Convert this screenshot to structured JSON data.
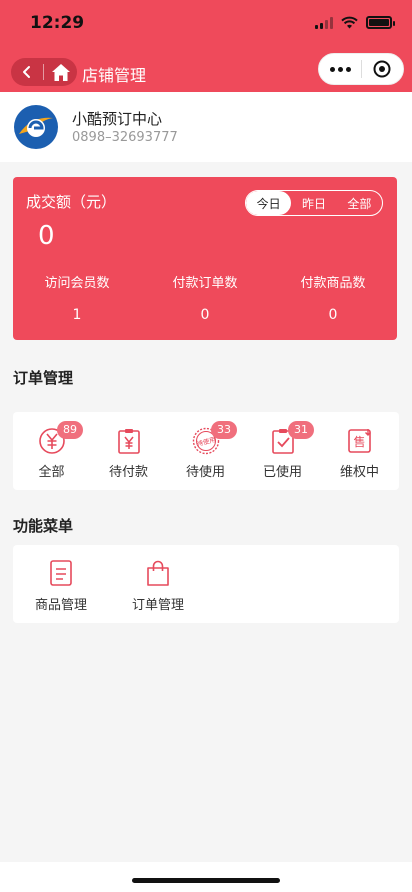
{
  "status_bar": {
    "time": "12:29"
  },
  "nav": {
    "title": "店铺管理"
  },
  "store": {
    "name": "小酷预订中心",
    "phone": "0898–32693777"
  },
  "stats": {
    "label": "成交额（元）",
    "value": "0",
    "tabs": [
      {
        "label": "今日",
        "active": true
      },
      {
        "label": "昨日",
        "active": false
      },
      {
        "label": "全部",
        "active": false
      }
    ],
    "metrics": [
      {
        "label": "访问会员数",
        "value": "1"
      },
      {
        "label": "付款订单数",
        "value": "0"
      },
      {
        "label": "付款商品数",
        "value": "0"
      }
    ]
  },
  "order_section": {
    "title": "订单管理",
    "items": [
      {
        "label": "全部",
        "badge": "89",
        "icon": "yen-circle-icon"
      },
      {
        "label": "待付款",
        "badge": "",
        "icon": "payment-clipboard-icon"
      },
      {
        "label": "待使用",
        "badge": "33",
        "icon": "pending-use-stamp-icon",
        "stamp_text": "待使用"
      },
      {
        "label": "已使用",
        "badge": "31",
        "icon": "checked-clipboard-icon"
      },
      {
        "label": "维权中",
        "badge": "",
        "icon": "after-sale-icon",
        "glyph": "售"
      }
    ]
  },
  "func_section": {
    "title": "功能菜单",
    "items": [
      {
        "label": "商品管理",
        "icon": "document-list-icon"
      },
      {
        "label": "订单管理",
        "icon": "shopping-bag-icon"
      }
    ]
  },
  "colors": {
    "brand": "#ef4a5b",
    "badge": "#f06f7d",
    "icon": "#e64a5c"
  }
}
